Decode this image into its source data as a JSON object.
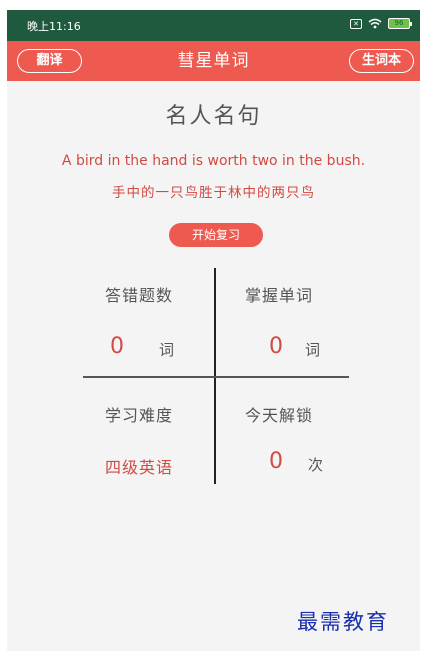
{
  "statusbar": {
    "time": "晚上11:16",
    "sim_icon": "sim-x-icon",
    "wifi_icon": "wifi-icon",
    "battery": "96"
  },
  "appbar": {
    "left_button": "翻译",
    "title": "彗星单词",
    "right_button": "生词本",
    "color": "#ee5a50"
  },
  "quote": {
    "heading": "名人名句",
    "english": "A bird in the hand is worth two in the bush.",
    "chinese": "手中的一只鸟胜于林中的两只鸟"
  },
  "review_button": "开始复习",
  "stats": {
    "wrong": {
      "label": "答错题数",
      "value": "0",
      "unit": "词"
    },
    "mastered": {
      "label": "掌握单词",
      "value": "0",
      "unit": "词"
    },
    "difficulty": {
      "label": "学习难度",
      "value": "四级英语"
    },
    "unlock": {
      "label": "今天解锁",
      "value": "0",
      "unit": "次"
    }
  },
  "watermark": "最需教育"
}
